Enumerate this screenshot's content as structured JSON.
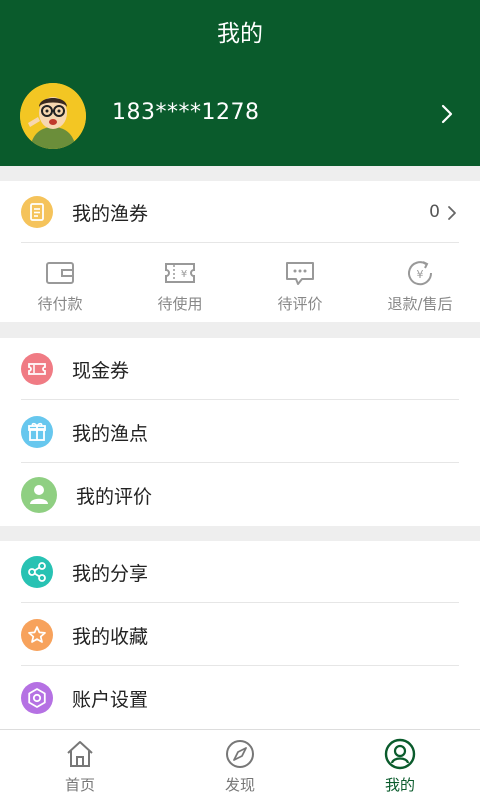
{
  "header": {
    "title": "我的",
    "phone": "183****1278"
  },
  "coupons_row": {
    "label": "我的渔券",
    "count": "0"
  },
  "orders": [
    {
      "label": "待付款",
      "icon": "wallet-icon"
    },
    {
      "label": "待使用",
      "icon": "ticket-icon"
    },
    {
      "label": "待评价",
      "icon": "comment-icon"
    },
    {
      "label": "退款/售后",
      "icon": "refund-icon"
    }
  ],
  "menu_group1": [
    {
      "label": "现金券",
      "icon": "cash-coupon-icon",
      "color": "#f07b84"
    },
    {
      "label": "我的渔点",
      "icon": "gift-icon",
      "color": "#67c7ee"
    },
    {
      "label": "我的评价",
      "icon": "user-icon",
      "color": "#8fcf82"
    }
  ],
  "menu_group2": [
    {
      "label": "我的分享",
      "icon": "share-icon",
      "color": "#28c2b3"
    },
    {
      "label": "我的收藏",
      "icon": "star-icon",
      "color": "#f7a25c"
    },
    {
      "label": "账户设置",
      "icon": "settings-icon",
      "color": "#b571e3"
    }
  ],
  "tabbar": [
    {
      "label": "首页",
      "icon": "home-icon",
      "active": false
    },
    {
      "label": "发现",
      "icon": "compass-icon",
      "active": false
    },
    {
      "label": "我的",
      "icon": "profile-icon",
      "active": true
    }
  ],
  "colors": {
    "brand": "#0a5b2c",
    "coupon_icon": "#f5c35b"
  }
}
